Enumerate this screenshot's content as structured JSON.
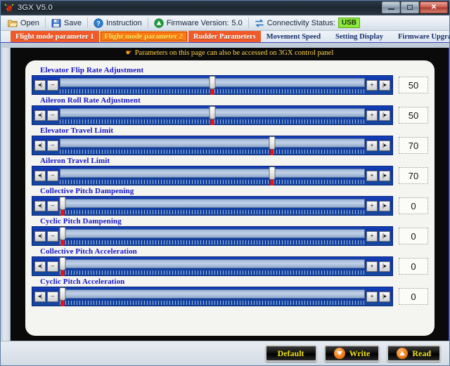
{
  "window": {
    "title": "3GX  V5.0",
    "app_icon": "bug-icon",
    "controls": {
      "minimize": "minimize-icon",
      "maximize": "maximize-icon",
      "close": "✕"
    }
  },
  "toolbar": {
    "open_label": "Open",
    "save_label": "Save",
    "instruction_label": "Instruction",
    "firmware_label": "Firmware Version:",
    "firmware_value": "5.0",
    "connectivity_label": "Connectivity Status:",
    "connectivity_value": "USB"
  },
  "tabs": [
    {
      "label": "Flight mode parameter 1",
      "selected": false,
      "style": "orange"
    },
    {
      "label": "Flight mode parameter 2",
      "selected": true,
      "style": "orange"
    },
    {
      "label": "Rudder Parameters",
      "selected": false,
      "style": "orange"
    },
    {
      "label": "Movement Speed",
      "selected": false,
      "style": "plain"
    },
    {
      "label": "Setting Display",
      "selected": false,
      "style": "plain"
    },
    {
      "label": "Firmware Upgrade",
      "selected": false,
      "style": "plain"
    }
  ],
  "notice": {
    "icon": "pointing-hand-icon",
    "text": "Parameters on this page can also be accessed on 3GX control panel"
  },
  "slider_buttons": {
    "home": "◂|",
    "minus": "–",
    "plus": "+",
    "end": "|▸"
  },
  "sliders": [
    {
      "label": "Elevator Flip Rate Adjustment",
      "value": "50",
      "percent": 50
    },
    {
      "label": "Aileron Roll Rate Adjustment",
      "value": "50",
      "percent": 50
    },
    {
      "label": "Elevator Travel Limit",
      "value": "70",
      "percent": 70
    },
    {
      "label": "Aileron Travel Limit",
      "value": "70",
      "percent": 70
    },
    {
      "label": "Collective Pitch Dampening",
      "value": "0",
      "percent": 0
    },
    {
      "label": "Cyclic Pitch Dampening",
      "value": "0",
      "percent": 0
    },
    {
      "label": "Collective Pitch Acceleration",
      "value": "0",
      "percent": 0
    },
    {
      "label": "Cyclic Pitch Acceleration",
      "value": "0",
      "percent": 0
    }
  ],
  "footer": {
    "default_label": "Default",
    "write_label": "Write",
    "read_label": "Read"
  },
  "colors": {
    "tab_orange": "#f05a28",
    "tab_selected": "#ff7a12",
    "label_blue": "#1616c8",
    "slider_blue": "#0f32a0",
    "notice_yellow": "#ffd34d",
    "usb_green": "#8ce83a",
    "button_yellow": "#f2e416",
    "accent_orange": "#f07a12",
    "red_marker": "#ef1111"
  }
}
